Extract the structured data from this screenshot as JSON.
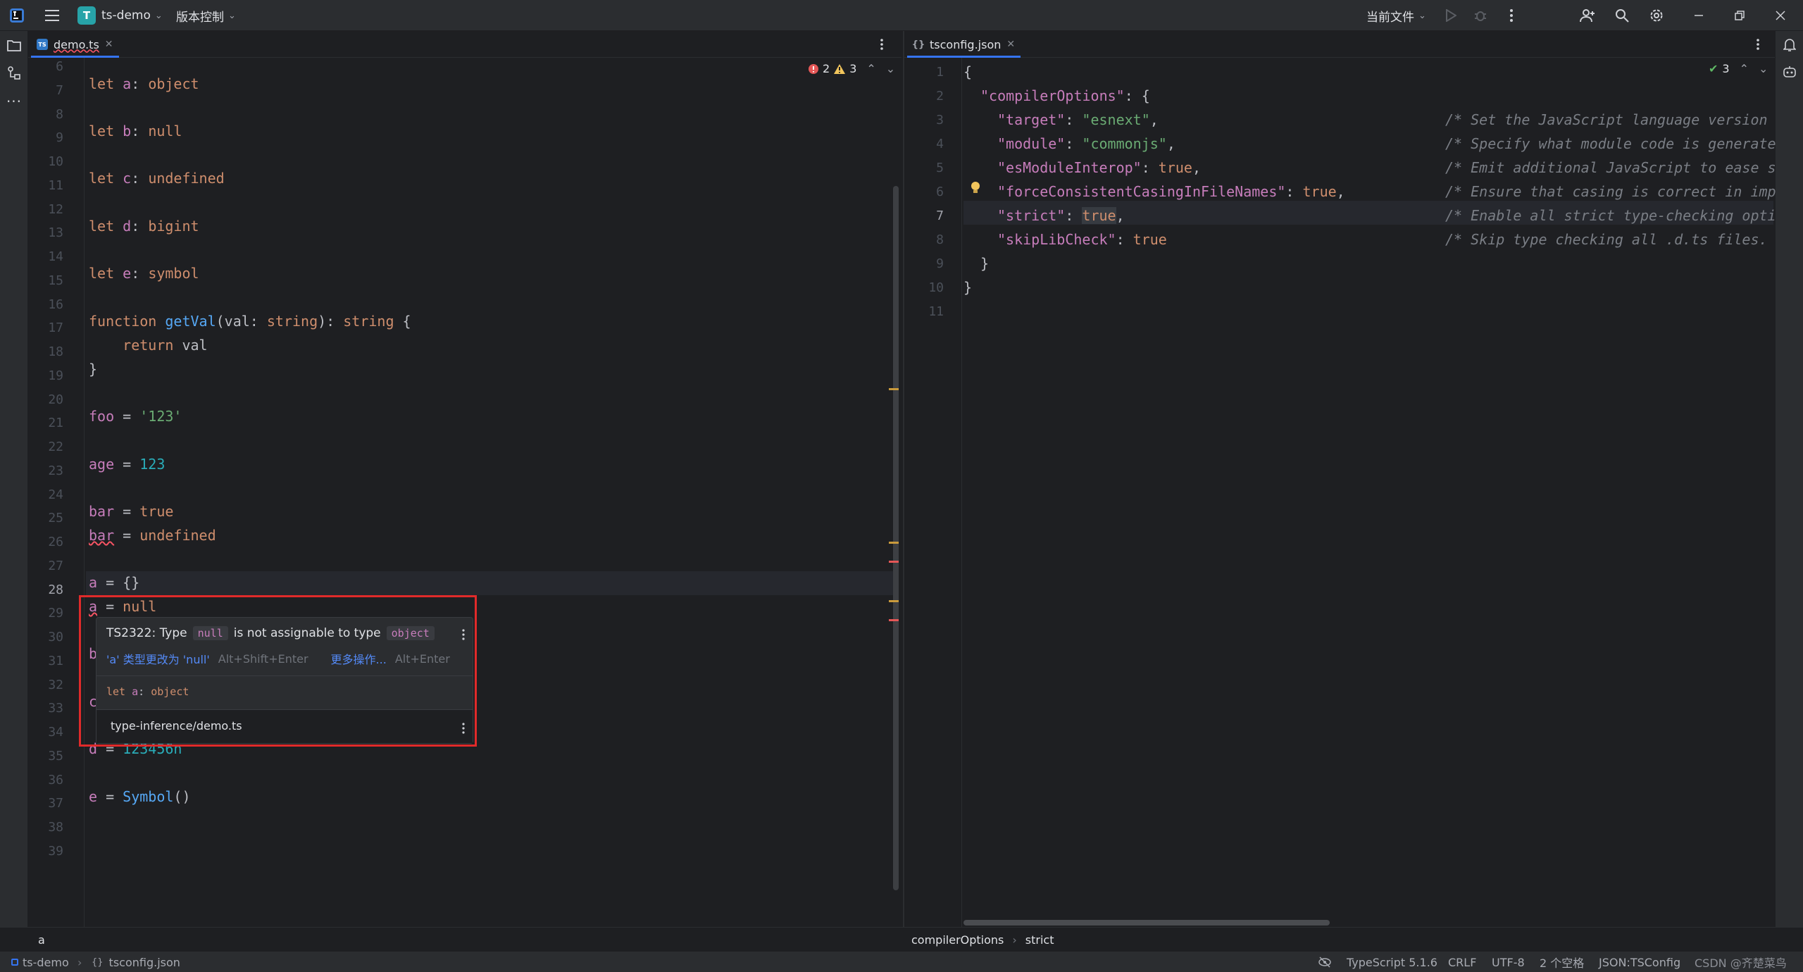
{
  "title_bar": {
    "project_badge": "T",
    "project_name": "ts-demo",
    "vcs_label": "版本控制",
    "run_config": "当前文件",
    "icons": [
      "app-logo-icon",
      "hamburger-menu-icon",
      "run-icon",
      "debug-icon",
      "more-vertical-icon",
      "add-user-icon",
      "search-icon",
      "settings-gear-icon",
      "minimize-icon",
      "restore-icon",
      "close-icon"
    ]
  },
  "left_strip": {
    "icons": [
      "project-folder-icon",
      "structure-icon",
      "more-tools-icon",
      "terminal-icon"
    ]
  },
  "right_strip": {
    "icons": [
      "notifications-bell-icon",
      "ai-assistant-icon",
      "git-icon"
    ]
  },
  "left_editor": {
    "tab_label": "demo.ts",
    "tab_icon_text": "TS",
    "error_count": "2",
    "warning_count": "3",
    "line_numbers": [
      "6",
      "7",
      "8",
      "9",
      "10",
      "11",
      "12",
      "13",
      "14",
      "15",
      "16",
      "17",
      "18",
      "19",
      "20",
      "21",
      "22",
      "23",
      "24",
      "25",
      "26",
      "27",
      "28",
      "29",
      "30",
      "31",
      "32",
      "33",
      "34",
      "35",
      "36",
      "37",
      "38",
      "39"
    ],
    "current_line": "28",
    "lines": {
      "l7": [
        "let ",
        "a",
        ": ",
        "object"
      ],
      "l9": [
        "let ",
        "b",
        ": ",
        "null"
      ],
      "l11": [
        "let ",
        "c",
        ": ",
        "undefined"
      ],
      "l13": [
        "let ",
        "d",
        ": ",
        "bigint"
      ],
      "l15": [
        "let ",
        "e",
        ": ",
        "symbol"
      ],
      "l17": [
        "function ",
        "getVal",
        "(",
        "val",
        ": ",
        "string",
        "): ",
        "string",
        " {"
      ],
      "l18": [
        "    ",
        "return ",
        "val"
      ],
      "l19": [
        "}"
      ],
      "l21": [
        "foo",
        " = ",
        "'123'"
      ],
      "l23": [
        "age",
        " = ",
        "123"
      ],
      "l25": [
        "bar",
        " = ",
        "true"
      ],
      "l26": [
        "bar",
        " = ",
        "undefined"
      ],
      "l28": [
        "a",
        " = {}"
      ],
      "l29": [
        "a",
        " = ",
        "null"
      ],
      "l31": [
        "b"
      ],
      "l33": [
        "c"
      ],
      "l35": [
        "d",
        " = ",
        "123456n"
      ],
      "l37": [
        "e",
        " = ",
        "Symbol",
        "()"
      ]
    }
  },
  "popup": {
    "error_prefix": "TS2322: Type",
    "error_type1": "null",
    "error_middle": "is not assignable to type",
    "error_type2": "object",
    "fix_action": "'a' 类型更改为 'null'",
    "fix_shortcut": "Alt+Shift+Enter",
    "more_actions": "更多操作...",
    "more_shortcut": "Alt+Enter",
    "decl_keyword": "let ",
    "decl_name": "a",
    "decl_sep": ": ",
    "decl_type": "object",
    "file_path": "type-inference/demo.ts"
  },
  "right_editor": {
    "tab_label": "tsconfig.json",
    "tab_icon_text": "{}",
    "check_count": "3",
    "line_numbers": [
      "1",
      "2",
      "3",
      "4",
      "5",
      "6",
      "7",
      "8",
      "9",
      "10",
      "11"
    ],
    "current_line": "7",
    "lines": {
      "l1": "{",
      "l2": [
        "\"compilerOptions\"",
        ": {"
      ],
      "l3": [
        "\"target\"",
        ": ",
        "\"esnext\"",
        ","
      ],
      "l4": [
        "\"module\"",
        ": ",
        "\"commonjs\"",
        ","
      ],
      "l5": [
        "\"esModuleInterop\"",
        ": ",
        "true",
        ","
      ],
      "l6": [
        "\"forceConsistentCasingInFileNames\"",
        ": ",
        "true",
        ","
      ],
      "l7": [
        "\"strict\"",
        ": ",
        "true",
        ","
      ],
      "l8": [
        "\"skipLibCheck\"",
        ": ",
        "true"
      ],
      "l9": "}",
      "l10": "}"
    },
    "comments": {
      "l3": "/* Set the JavaScript language version ",
      "l4": "/* Specify what module code is generate",
      "l5": "/* Emit additional JavaScript to ease s",
      "l6": "/* Ensure that casing is correct in imp",
      "l7": "/* Enable all strict type-checking opti",
      "l8": "/* Skip type checking all .d.ts files."
    }
  },
  "breadcrumbs": {
    "left": "a",
    "right": [
      "compilerOptions",
      "strict"
    ]
  },
  "status_bar": {
    "project": "ts-demo",
    "file": "tsconfig.json",
    "items": [
      "TypeScript 5.1.6",
      "CRLF",
      "UTF-8",
      "2 个空格",
      "JSON:TSConfig"
    ],
    "watermark": "CSDN @齐楚菜鸟"
  }
}
